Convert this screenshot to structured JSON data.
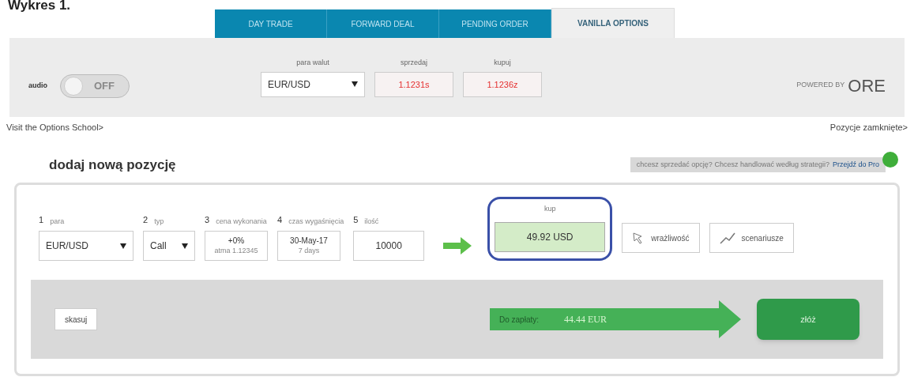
{
  "caption": "Wykres 1.",
  "tabs": [
    {
      "label": "DAY TRADE",
      "selected": false
    },
    {
      "label": "FORWARD DEAL",
      "selected": false
    },
    {
      "label": "PENDING ORDER",
      "selected": false
    },
    {
      "label": "VANILLA OPTIONS",
      "selected": true
    }
  ],
  "toolbar": {
    "audio": {
      "label": "audio",
      "on": false,
      "text": "OFF"
    },
    "pair": {
      "label": "para walut",
      "value": "EUR/USD"
    },
    "sell": {
      "label": "sprzedaj",
      "value": "1.1231s"
    },
    "buy": {
      "label": "kupuj",
      "value": "1.1236z"
    },
    "powered_by": "POWERED BY",
    "brand": "ORE"
  },
  "links": {
    "left": "Visit the Options School>",
    "right": "Pozycje zamknięte>"
  },
  "section_title": "dodaj nową pozycję",
  "banner": {
    "text": "chcesz sprzedać opcję? Chcesz handlować według strategii?",
    "link": "Przejdź do Pro"
  },
  "fields": [
    {
      "kind": "select",
      "number": "1",
      "label": "para",
      "value": "EUR/USD"
    },
    {
      "kind": "select",
      "number": "2",
      "label": "typ",
      "value": "Call"
    },
    {
      "kind": "stack",
      "number": "3",
      "label": "cena wykonania",
      "value": "+0%",
      "sub": "atma 1.12345"
    },
    {
      "kind": "stack",
      "number": "4",
      "label": "czas wygaśnięcia",
      "value": "30-May-17",
      "sub": "7 days"
    },
    {
      "kind": "input",
      "number": "5",
      "label": "ilość",
      "value": "10000"
    }
  ],
  "price": {
    "label": "kup",
    "value": "49.92 USD",
    "highlighted": true
  },
  "actions": [
    {
      "kind": "sensitivity",
      "label": "wrażliwość"
    },
    {
      "kind": "scenarios",
      "label": "scenariusze"
    }
  ],
  "footer": {
    "cancel": "skasuj",
    "due_label": "Do zapłaty:",
    "due_value": "44.44 EUR",
    "submit": "złóż"
  }
}
